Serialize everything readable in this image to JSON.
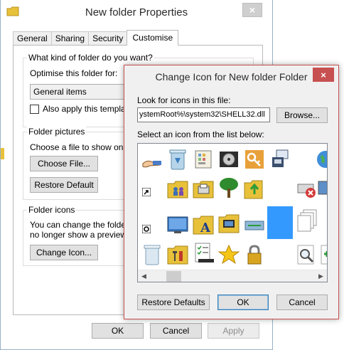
{
  "props": {
    "title": "New folder Properties",
    "close_glyph": "×",
    "tabs": [
      "General",
      "Sharing",
      "Security",
      "Customise"
    ],
    "group1": {
      "title": "What kind of folder do you want?",
      "optimise_label": "Optimise this folder for:",
      "combo_value": "General items",
      "apply_template": "Also apply this template to"
    },
    "group2": {
      "title": "Folder pictures",
      "desc": "Choose a file to show on this",
      "choose_file": "Choose File...",
      "restore_default": "Restore Default"
    },
    "group3": {
      "title": "Folder icons",
      "desc1": "You can change the folder ic",
      "desc2": "no longer show a preview of",
      "change_icon": "Change Icon..."
    },
    "ok": "OK",
    "cancel": "Cancel",
    "apply": "Apply"
  },
  "dialog": {
    "title": "Change Icon for New folder Folder",
    "close_glyph": "×",
    "look_label": "Look for icons in this file:",
    "path_value": "ystemRoot%\\system32\\SHELL32.dll",
    "browse": "Browse...",
    "select_label": "Select an icon from the list below:",
    "icons": [
      "hand-share-icon",
      "recycle-bin-full-icon",
      "control-panel-icon",
      "media-disc-icon",
      "key-icon",
      "printer-network-icon",
      "globe-partial-icon",
      "shortcut-overlay-icon",
      "folder-users-icon",
      "folder-printer-icon",
      "tree-icon",
      "folder-up-arrow-icon",
      "error-overlay-icon",
      "monitor-partial-icon",
      "sync-overlay-icon",
      "desktop-monitor-icon",
      "font-folder-icon",
      "folder-computer-icon",
      "network-icon",
      "selected-blank-icon",
      "documents-stack-icon",
      "recycle-bin-empty-icon",
      "folder-tools-icon",
      "checklist-icon",
      "star-icon",
      "padlock-icon",
      "magnifier-icon",
      "add-partial-icon"
    ],
    "restore_defaults": "Restore Defaults",
    "ok": "OK",
    "cancel": "Cancel"
  },
  "colors": {
    "accent_close": "#c75050",
    "selection": "#3399ff",
    "folder": "#e8c13a"
  }
}
